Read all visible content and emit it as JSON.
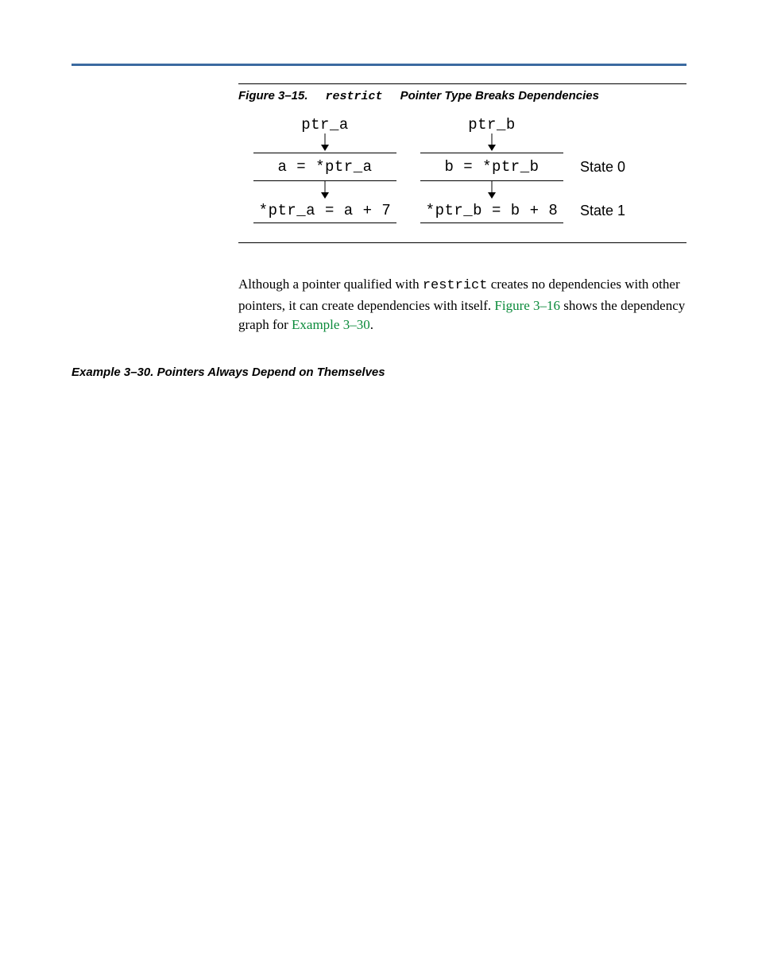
{
  "figure": {
    "label": "Figure 3–15.",
    "keyword": "restrict",
    "title": "Pointer Type Breaks Dependencies",
    "diagram": {
      "top": {
        "a": "ptr_a",
        "b": "ptr_b"
      },
      "mid": {
        "a": "a = *ptr_a",
        "b": "b = *ptr_b",
        "state": "State 0"
      },
      "bot": {
        "a": "*ptr_a = a + 7",
        "b": "*ptr_b = b + 8",
        "state": "State 1"
      }
    }
  },
  "paragraph": {
    "t1": "Although a pointer qualified with ",
    "kw": "restrict",
    "t2": " creates no dependencies with other pointers, it can create dependencies with itself. ",
    "link1": "Figure 3–16",
    "t3": " shows the dependency graph for ",
    "link2": "Example 3–30",
    "t4": "."
  },
  "example": {
    "label": "Example 3–30. Pointers Always Depend on Themselves"
  }
}
